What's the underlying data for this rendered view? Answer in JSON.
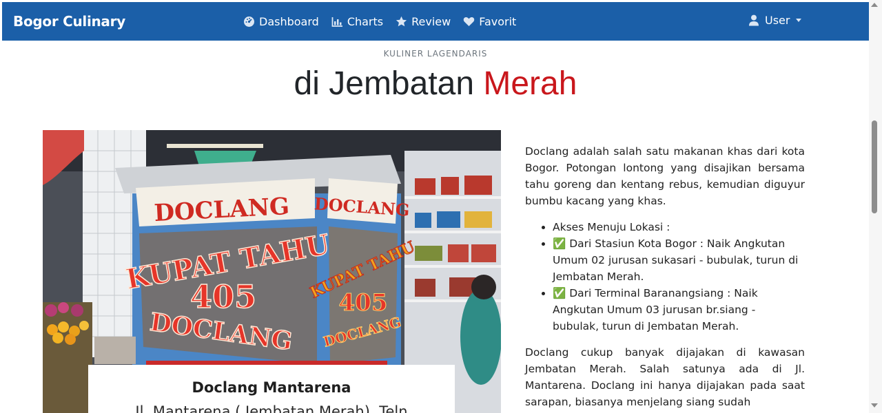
{
  "navbar": {
    "brand": "Bogor Culinary",
    "items": [
      {
        "label": "Dashboard",
        "icon": "dashboard-icon"
      },
      {
        "label": "Charts",
        "icon": "chart-icon"
      },
      {
        "label": "Review",
        "icon": "star-icon"
      },
      {
        "label": "Favorit",
        "icon": "heart-icon"
      }
    ],
    "user": {
      "label": "User",
      "icon": "user-icon"
    },
    "color": "#1b5fa8"
  },
  "header": {
    "kicker": "KULINER LAGENDARIS",
    "title_prefix": "di Jembatan ",
    "title_highlight": "Merah",
    "highlight_color": "#c9171c"
  },
  "photo": {
    "signs": {
      "doclang": "DOCLANG",
      "kupat_tahu": "KUPAT TAHU",
      "number": "405"
    },
    "caption_title": "Doclang Mantarena",
    "caption_address": "Jl. Mantarena ( Jembatan Merah), Teln"
  },
  "article": {
    "intro": "Doclang adalah salah satu makanan khas dari kota Bogor. Potongan lontong yang disajikan bersama tahu goreng dan kentang rebus, kemudian diguyur bumbu kacang yang khas.",
    "access_items": [
      "Akses Menuju Lokasi :",
      "✅ Dari Stasiun Kota Bogor : Naik Angkutan Umum 02 jurusan sukasari - bubulak, turun di Jembatan Merah.",
      "✅ Dari Terminal Baranangsiang : Naik Angkutan Umum 03 jurusan br.siang - bubulak, turun di Jembatan Merah."
    ],
    "closing": "Doclang cukup banyak dijajakan di kawasan Jembatan Merah. Salah satunya ada di Jl. Mantarena. Doclang ini hanya dijajakan pada saat sarapan, biasanya menjelang siang sudah"
  }
}
